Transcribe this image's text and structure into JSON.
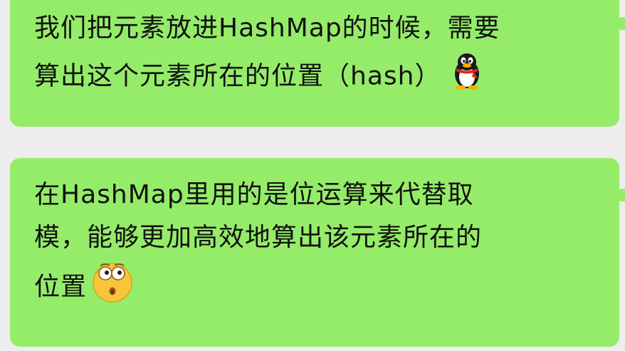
{
  "messages": [
    {
      "lines": [
        "我们把元素放进HashMap的时候，需要",
        "算出这个元素所在的位置（hash）"
      ],
      "emoji": "qq-penguin-icon"
    },
    {
      "lines": [
        "在HashMap里用的是位运算来代替取",
        "模，能够更加高效地算出该元素所在的",
        "位置"
      ],
      "emoji": "surprised-face-icon"
    }
  ],
  "colors": {
    "bubble": "#95ec69",
    "background": "#ededed",
    "text": "#111111"
  }
}
